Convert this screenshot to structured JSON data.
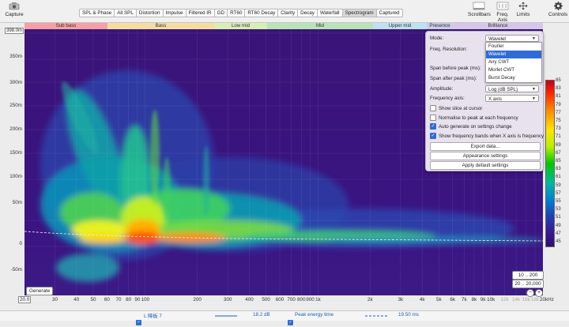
{
  "toolbar": {
    "capture_label": "Capture",
    "tabs": [
      "SPL & Phase",
      "All SPL",
      "Distortion",
      "Impulse",
      "Filtered IR",
      "GD",
      "RT60",
      "RT60 Decay",
      "Clarity",
      "Decay",
      "Waterfall",
      "Spectrogram",
      "Captured"
    ],
    "active_tab": "Spectrogram",
    "scrollbars_label": "Scrollbars",
    "freq_axis_label": "Freq. Axis",
    "limits_label": "Limits",
    "controls_label": "Controls"
  },
  "bands": [
    "Sub bass",
    "Bass",
    "Low mid",
    "Mid",
    "Upper mid",
    "Presence",
    "Brilliance"
  ],
  "band_colors": [
    "#f3a0a6",
    "#f5dca0",
    "#d8eeb4",
    "#b8e4b8",
    "#bfe1f0",
    "#c8cde8",
    "#d7c6ea"
  ],
  "y_axis": {
    "top_value": "398.0m",
    "ticks": [
      "350m",
      "300m",
      "250m",
      "200m",
      "150m",
      "100m",
      "50m",
      "0",
      "-50m"
    ]
  },
  "x_axis": {
    "start": "20.0",
    "end": "20kHz",
    "ticks": [
      {
        "label": "30",
        "faded": false
      },
      {
        "label": "40",
        "faded": false
      },
      {
        "label": "50",
        "faded": false
      },
      {
        "label": "60",
        "faded": false
      },
      {
        "label": "70",
        "faded": false
      },
      {
        "label": "80",
        "faded": false
      },
      {
        "label": "90",
        "faded": false
      },
      {
        "label": "100",
        "faded": false
      },
      {
        "label": "200",
        "faded": false
      },
      {
        "label": "300",
        "faded": false
      },
      {
        "label": "400",
        "faded": false
      },
      {
        "label": "500",
        "faded": false
      },
      {
        "label": "600",
        "faded": false
      },
      {
        "label": "700",
        "faded": false
      },
      {
        "label": "800",
        "faded": false
      },
      {
        "label": "900",
        "faded": false
      },
      {
        "label": "1k",
        "faded": false
      },
      {
        "label": "2k",
        "faded": false
      },
      {
        "label": "3k",
        "faded": false
      },
      {
        "label": "4k",
        "faded": false
      },
      {
        "label": "5k",
        "faded": false
      },
      {
        "label": "6k",
        "faded": false
      },
      {
        "label": "7k",
        "faded": false
      },
      {
        "label": "8k",
        "faded": false
      },
      {
        "label": "9k",
        "faded": false
      },
      {
        "label": "10k",
        "faded": false
      },
      {
        "label": "12k",
        "faded": true
      },
      {
        "label": "14k",
        "faded": true
      },
      {
        "label": "16k",
        "faded": true
      },
      {
        "label": "18k",
        "faded": true
      }
    ]
  },
  "color_scale": {
    "ticks": [
      "85",
      "83",
      "81",
      "79",
      "77",
      "75",
      "73",
      "71",
      "69",
      "67",
      "65",
      "63",
      "61",
      "59",
      "57",
      "55",
      "53",
      "51",
      "49",
      "47",
      "45"
    ]
  },
  "panel": {
    "mode_label": "Mode:",
    "mode_value": "Wavelet",
    "freq_res_label": "Freq. Resolution:",
    "span_before_label": "Span before peak (ms):",
    "span_after_label": "Span after peak (ms):",
    "mode_options": [
      "Fourier",
      "Wavelet",
      "Airy CWT",
      "Morlet CWT",
      "Burst Decay"
    ],
    "mode_selected": "Wavelet",
    "amplitude_label": "Amplitude:",
    "amplitude_value": "Log (dB SPL)",
    "freq_axis_label": "Frequency axis:",
    "freq_axis_value": "X axis",
    "checkboxes": [
      {
        "label": "Show slice at cursor",
        "checked": false
      },
      {
        "label": "Normalise to peak at each frequency",
        "checked": false
      },
      {
        "label": "Auto generate on settings change",
        "checked": true
      },
      {
        "label": "Show frequency bands when X axis is frequency",
        "checked": true
      }
    ],
    "buttons": [
      "Export data...",
      "Appearance settings",
      "Apply default settings"
    ]
  },
  "generate_label": "Generate",
  "range_buttons": [
    "10 .. 200",
    "20 .. 20,000"
  ],
  "legend": {
    "name": "L 障板 7",
    "value": "18.2 dB",
    "peak_label": "Peak energy time",
    "peak_value": "19.50 ms"
  }
}
